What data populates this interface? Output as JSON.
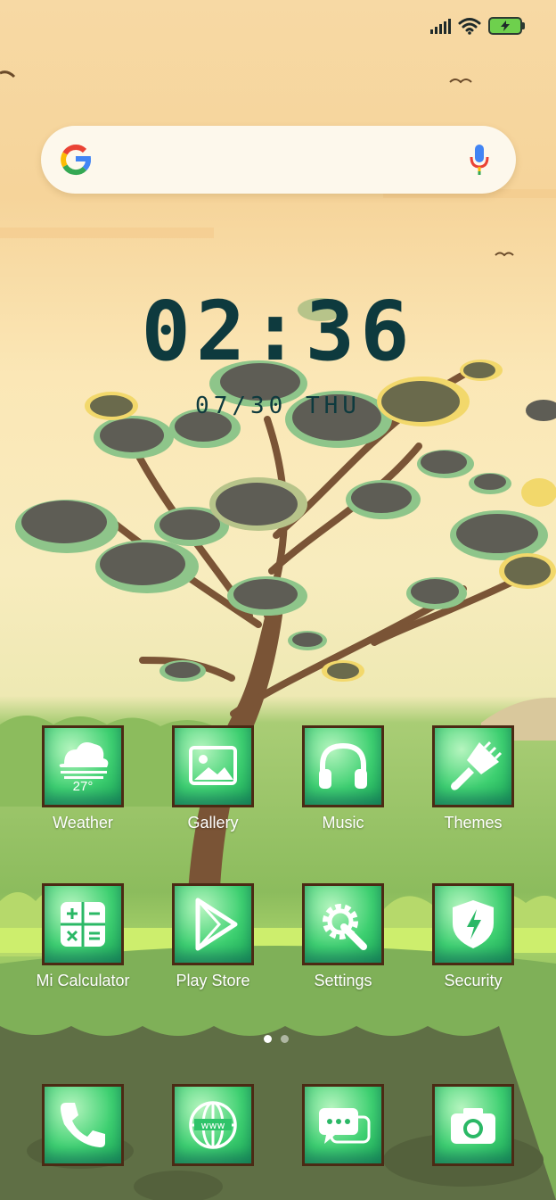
{
  "status_bar": {
    "icons": [
      "signal-icon",
      "wifi-icon",
      "battery-charging-icon"
    ]
  },
  "search": {
    "placeholder": "",
    "icons": [
      "google-logo",
      "microphone-icon"
    ]
  },
  "clock": {
    "time": "02:36",
    "date": "07/30 THU"
  },
  "apps": [
    {
      "label": "Weather",
      "icon": "weather-icon",
      "badge": "27°"
    },
    {
      "label": "Gallery",
      "icon": "gallery-icon"
    },
    {
      "label": "Music",
      "icon": "headphones-icon"
    },
    {
      "label": "Themes",
      "icon": "paintbrush-icon"
    },
    {
      "label": "Mi Calculator",
      "icon": "calculator-icon"
    },
    {
      "label": "Play Store",
      "icon": "play-store-icon"
    },
    {
      "label": "Settings",
      "icon": "settings-gear-icon"
    },
    {
      "label": "Security",
      "icon": "security-shield-icon"
    }
  ],
  "dock": [
    {
      "icon": "phone-icon"
    },
    {
      "icon": "browser-globe-icon"
    },
    {
      "icon": "messaging-icon"
    },
    {
      "icon": "camera-icon"
    }
  ],
  "page_indicator": {
    "count": 2,
    "active": 1
  },
  "colors": {
    "clock": "#0e3a3e",
    "tile_border": "#4b2a14",
    "tile_green": "#3ed071",
    "label_text": "#ffffff"
  }
}
